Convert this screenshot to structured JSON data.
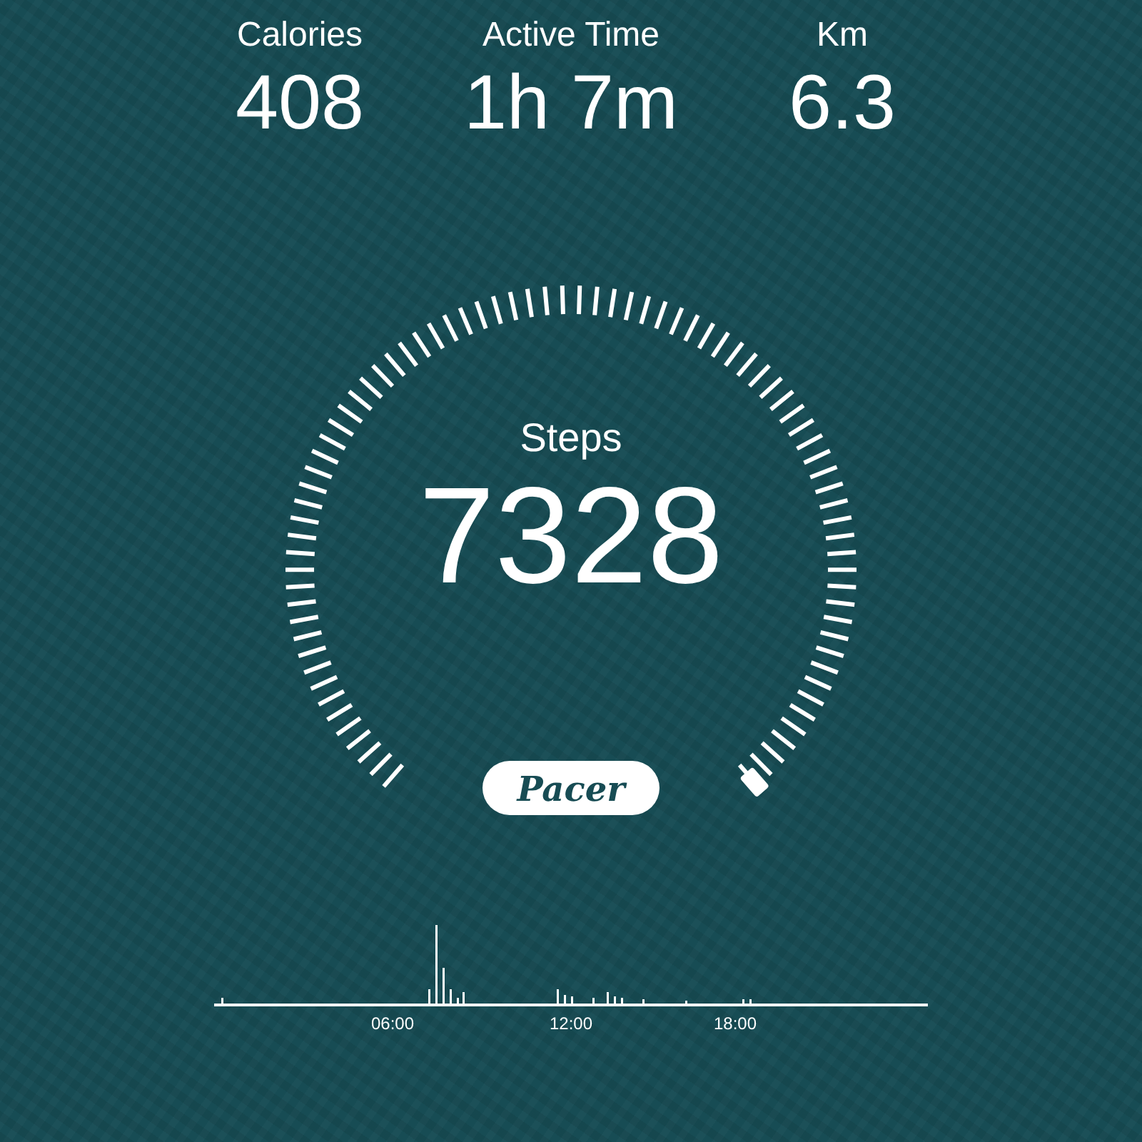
{
  "stats": [
    {
      "label": "Calories",
      "value": "408"
    },
    {
      "label": "Active Time",
      "value": "1h 7m"
    },
    {
      "label": "Km",
      "value": "6.3"
    }
  ],
  "gauge": {
    "label": "Steps",
    "value": "7328"
  },
  "logo": "Pacer",
  "activity": {
    "time_labels": [
      "06:00",
      "12:00",
      "18:00"
    ]
  }
}
